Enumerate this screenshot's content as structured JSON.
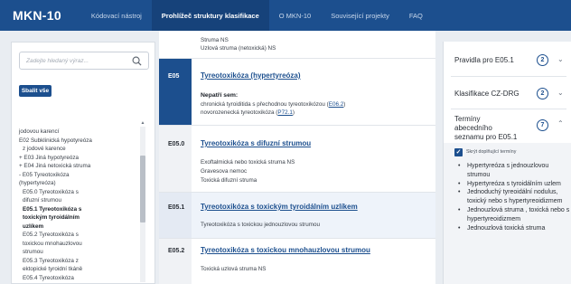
{
  "nav": {
    "brand": "MKN-10",
    "items": [
      "Kódovací nástroj",
      "Prohlížeč struktury klasifikace",
      "O MKN-10",
      "Související projekty",
      "FAQ"
    ]
  },
  "search": {
    "placeholder": "Zadejte hledaný výraz..."
  },
  "collapse_label": "Sbalit vše",
  "tree": [
    "jodovou karencí",
    "E02 Subklinická hypotyreóza",
    "z jodové karence",
    "+ E03 Jiná hypotyreóza",
    "+ E04 Jiná netoxická struma",
    "- E05 Tyreotoxikóza",
    "(hypertyreóza)",
    "E05.0 Tyreotoxikóza s",
    "difuzní strumou",
    "E05.1 Tyreotoxikóza s",
    "toxickým tyroidálním",
    "uzlíkem",
    "E05.2 Tyreotoxikóza s",
    "toxickou mnohauzlovou",
    "strumou",
    "E05.3 Tyreotoxikóza z",
    "ektopické tyroidní tkáně",
    "E05.4 Tyreotoxikóza"
  ],
  "main": {
    "top_lines": [
      "Struma NS",
      "Uzlová struma (netoxická) NS"
    ],
    "e05": {
      "code": "E05",
      "title": "Tyreotoxikóza (hypertyreóza)",
      "incl_label": "Nepatří sem:",
      "line1_pre": "chronická tyroiditida s přechodnou tyreotoxikózou (",
      "line1_ref": "E06.2",
      "line1_post": ")",
      "line2_pre": "novorozenecká tyreotoxikóza (",
      "line2_ref": "P72.1",
      "line2_post": ")"
    },
    "e050": {
      "code": "E05.0",
      "title": "Tyreotoxikóza s difuzní strumou",
      "lines": [
        "Exoftalmická nebo toxická struma NS",
        "Gravesova nemoc",
        "Toxická difuzní struma"
      ]
    },
    "e051": {
      "code": "E05.1",
      "title": "Tyreotoxikóza s toxickým tyroidálním uzlíkem",
      "lines": [
        "Tyreotoxikóza s toxickou jednouzlovou strumou"
      ]
    },
    "e052": {
      "code": "E05.2",
      "title": "Tyreotoxikóza s toxickou mnohauzlovou strumou",
      "lines": [
        "Toxická uzlová struma NS"
      ]
    }
  },
  "right": {
    "acc1": {
      "title": "Pravidla pro E05.1",
      "count": "2"
    },
    "acc2": {
      "title": "Klasifikace CZ-DRG",
      "count": "2"
    },
    "acc3": {
      "title_lines": [
        "Termíny",
        "abecedního",
        "seznamu pro E05.1"
      ],
      "count": "7"
    },
    "checkbox_label": "Skrýt doplňující termíny",
    "terms": [
      "Hypertyreóza s jednouzlovou strumou",
      "Hypertyreóza s tyroidálním uzlem",
      "Jednoduchý tyreoidální nodulus, toxický nebo s hypertyreoidizmem",
      "Jednouzlová struma , toxická nebo s hypertyreoidizmem",
      "Jednouzlová toxická struma"
    ]
  },
  "colors": {
    "nav": "#1c4f8e",
    "accent": "#1c4f8e",
    "highlight": "#eef3fa"
  }
}
